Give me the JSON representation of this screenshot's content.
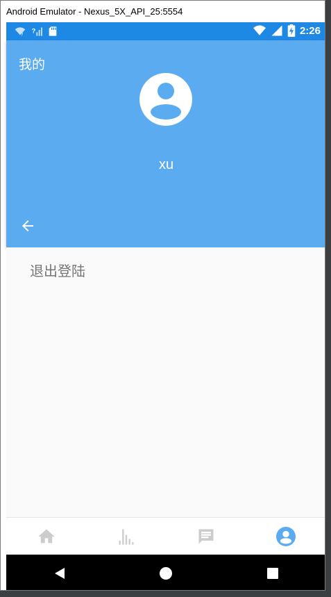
{
  "window": {
    "title": "Android Emulator - Nexus_5X_API_25:5554"
  },
  "status_bar": {
    "time": "2:26",
    "icons": [
      "wifi-unknown-icon",
      "signal-unknown-icon",
      "sd-card-icon",
      "wifi-icon",
      "signal-icon",
      "battery-charging-icon"
    ]
  },
  "app_bar": {
    "title": "我的",
    "username": "xu",
    "avatar_icon": "account-circle-icon",
    "back_icon": "arrow-back-icon"
  },
  "content": {
    "logout_label": "退出登陆"
  },
  "bottom_nav": {
    "items": [
      {
        "icon": "home-icon",
        "active": false
      },
      {
        "icon": "bar-chart-icon",
        "active": false
      },
      {
        "icon": "message-icon",
        "active": false
      },
      {
        "icon": "account-circle-icon",
        "active": true
      }
    ],
    "active_color": "#5aabef",
    "inactive_color": "#cccccc"
  },
  "system_nav": {
    "icons": [
      "back-triangle-icon",
      "home-circle-icon",
      "recents-square-icon"
    ]
  },
  "colors": {
    "status_bar": "#1e88e5",
    "app_bar": "#5aabef",
    "content_bg": "#fafafa",
    "logout_text": "#757575"
  }
}
